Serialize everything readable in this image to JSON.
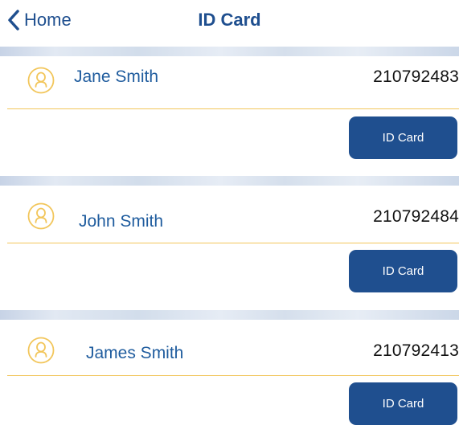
{
  "nav": {
    "back_label": "Home",
    "title": "ID Card"
  },
  "cards": [
    {
      "name": "Jane Smith",
      "id_number": "210792483",
      "button_label": "ID Card"
    },
    {
      "name": "John Smith",
      "id_number": "210792484",
      "button_label": "ID Card"
    },
    {
      "name": "James Smith",
      "id_number": "210792413",
      "button_label": "ID Card"
    }
  ],
  "icons": {
    "back": "chevron-left-icon",
    "avatar": "user-avatar-icon"
  },
  "colors": {
    "accent": "#1f4f8f",
    "name_text": "#1f5c9e",
    "avatar": "#f2c65b",
    "rule": "#f2c65b"
  }
}
